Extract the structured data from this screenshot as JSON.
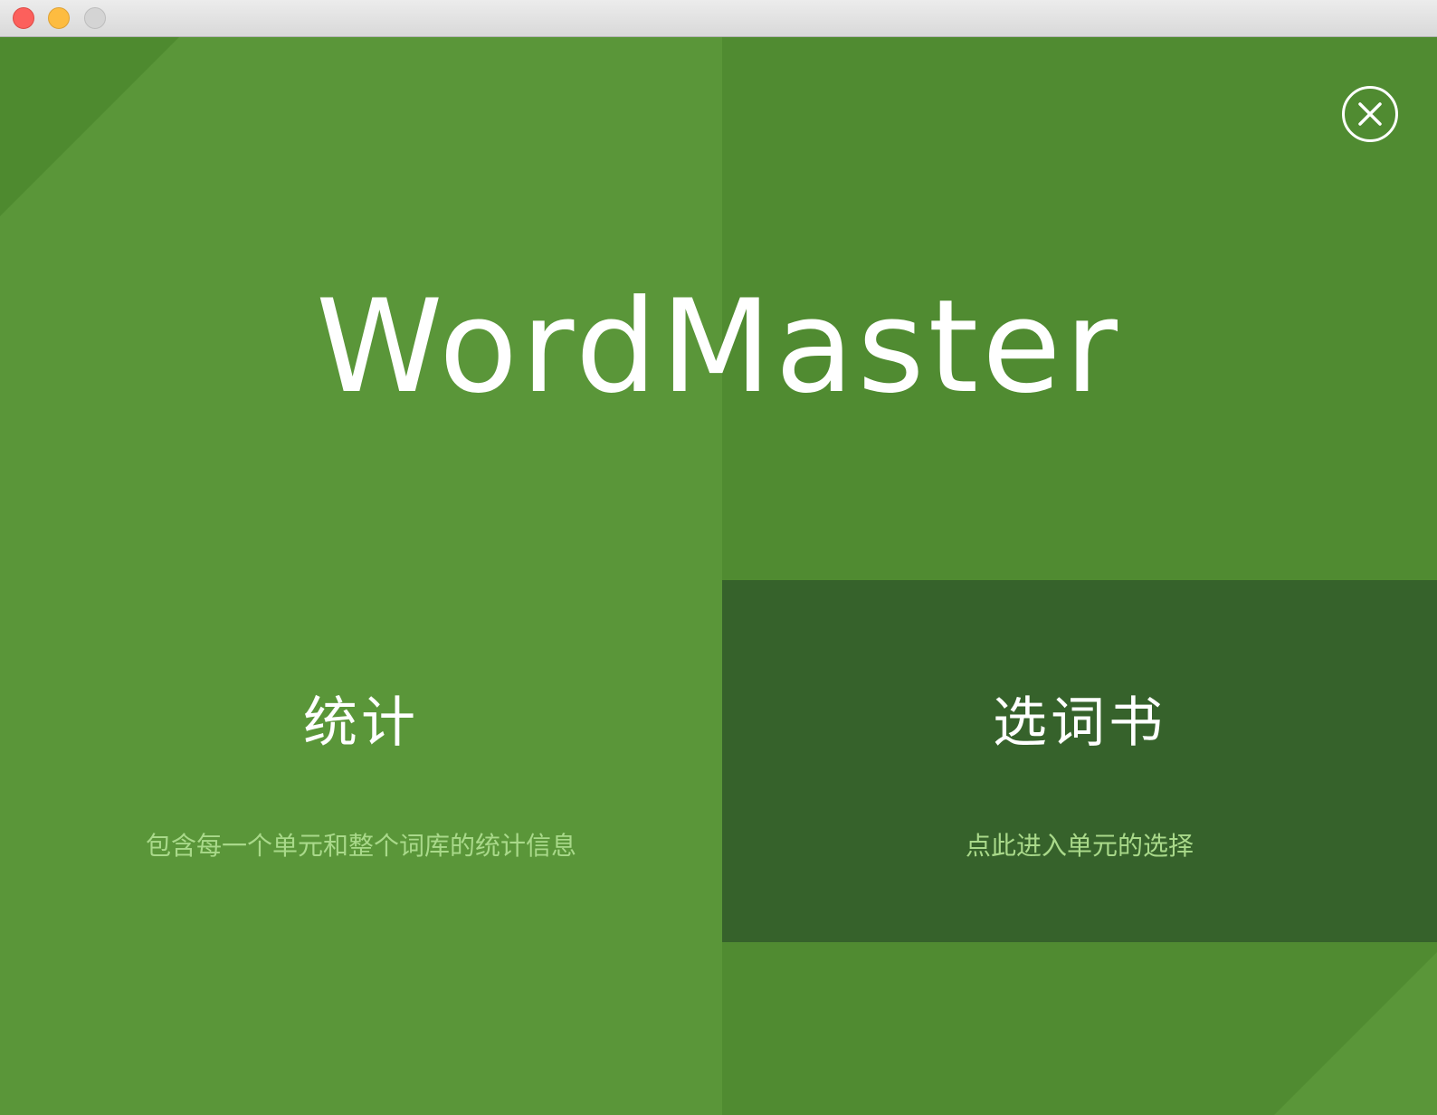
{
  "window": {
    "traffic_lights": [
      "close",
      "minimize",
      "zoom"
    ]
  },
  "app": {
    "title": "WordMaster"
  },
  "close_button": {
    "icon": "close-circle-icon"
  },
  "cards": {
    "stats": {
      "title": "统计",
      "description": "包含每一个单元和整个词库的统计信息"
    },
    "choose_book": {
      "title": "选词书",
      "description": "点此进入单元的选择"
    }
  },
  "colors": {
    "panel_left": "#5a9639",
    "panel_right": "#508b31",
    "panel_selected": "#36622b",
    "desc_text": "#a9d98a"
  }
}
